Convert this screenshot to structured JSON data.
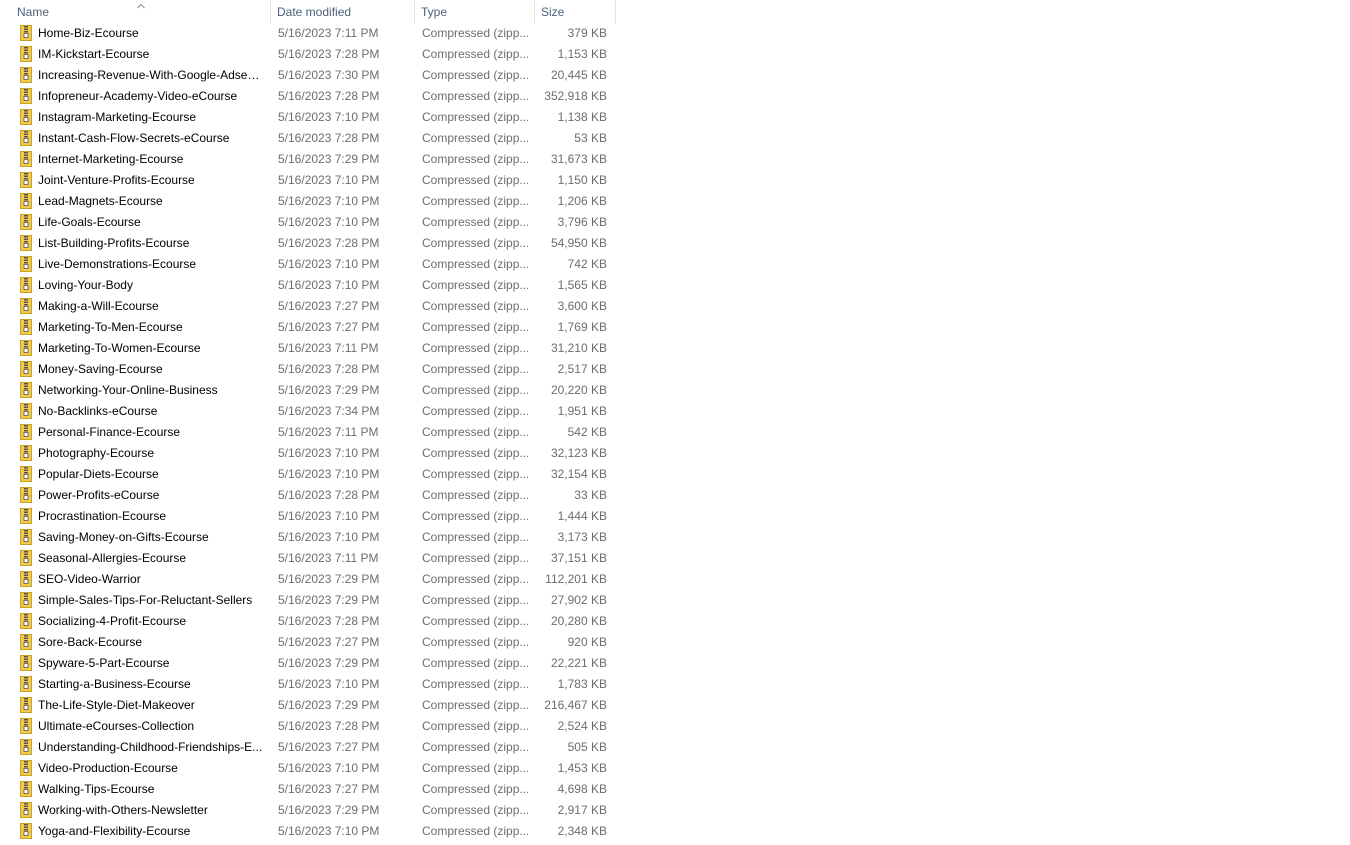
{
  "columns": {
    "name": "Name",
    "date_modified": "Date modified",
    "type": "Type",
    "size": "Size"
  },
  "sort_indicator": "chevron-up-icon",
  "file_icon": "zip-folder-icon",
  "colors": {
    "header_text": "#4c607a",
    "secondary_text": "#6d6d6d",
    "zip_folder": "#f2c94c"
  },
  "files": [
    {
      "name": "Home-Biz-Ecourse",
      "date": "5/16/2023 7:11 PM",
      "type": "Compressed (zipp...",
      "size": "379 KB"
    },
    {
      "name": "IM-Kickstart-Ecourse",
      "date": "5/16/2023 7:28 PM",
      "type": "Compressed (zipp...",
      "size": "1,153 KB"
    },
    {
      "name": "Increasing-Revenue-With-Google-Adsense",
      "date": "5/16/2023 7:30 PM",
      "type": "Compressed (zipp...",
      "size": "20,445 KB"
    },
    {
      "name": "Infopreneur-Academy-Video-eCourse",
      "date": "5/16/2023 7:28 PM",
      "type": "Compressed (zipp...",
      "size": "352,918 KB"
    },
    {
      "name": "Instagram-Marketing-Ecourse",
      "date": "5/16/2023 7:10 PM",
      "type": "Compressed (zipp...",
      "size": "1,138 KB"
    },
    {
      "name": "Instant-Cash-Flow-Secrets-eCourse",
      "date": "5/16/2023 7:28 PM",
      "type": "Compressed (zipp...",
      "size": "53 KB"
    },
    {
      "name": "Internet-Marketing-Ecourse",
      "date": "5/16/2023 7:29 PM",
      "type": "Compressed (zipp...",
      "size": "31,673 KB"
    },
    {
      "name": "Joint-Venture-Profits-Ecourse",
      "date": "5/16/2023 7:10 PM",
      "type": "Compressed (zipp...",
      "size": "1,150 KB"
    },
    {
      "name": "Lead-Magnets-Ecourse",
      "date": "5/16/2023 7:10 PM",
      "type": "Compressed (zipp...",
      "size": "1,206 KB"
    },
    {
      "name": "Life-Goals-Ecourse",
      "date": "5/16/2023 7:10 PM",
      "type": "Compressed (zipp...",
      "size": "3,796 KB"
    },
    {
      "name": "List-Building-Profits-Ecourse",
      "date": "5/16/2023 7:28 PM",
      "type": "Compressed (zipp...",
      "size": "54,950 KB"
    },
    {
      "name": "Live-Demonstrations-Ecourse",
      "date": "5/16/2023 7:10 PM",
      "type": "Compressed (zipp...",
      "size": "742 KB"
    },
    {
      "name": "Loving-Your-Body",
      "date": "5/16/2023 7:10 PM",
      "type": "Compressed (zipp...",
      "size": "1,565 KB"
    },
    {
      "name": "Making-a-Will-Ecourse",
      "date": "5/16/2023 7:27 PM",
      "type": "Compressed (zipp...",
      "size": "3,600 KB"
    },
    {
      "name": "Marketing-To-Men-Ecourse",
      "date": "5/16/2023 7:27 PM",
      "type": "Compressed (zipp...",
      "size": "1,769 KB"
    },
    {
      "name": "Marketing-To-Women-Ecourse",
      "date": "5/16/2023 7:11 PM",
      "type": "Compressed (zipp...",
      "size": "31,210 KB"
    },
    {
      "name": "Money-Saving-Ecourse",
      "date": "5/16/2023 7:28 PM",
      "type": "Compressed (zipp...",
      "size": "2,517 KB"
    },
    {
      "name": "Networking-Your-Online-Business",
      "date": "5/16/2023 7:29 PM",
      "type": "Compressed (zipp...",
      "size": "20,220 KB"
    },
    {
      "name": "No-Backlinks-eCourse",
      "date": "5/16/2023 7:34 PM",
      "type": "Compressed (zipp...",
      "size": "1,951 KB"
    },
    {
      "name": "Personal-Finance-Ecourse",
      "date": "5/16/2023 7:11 PM",
      "type": "Compressed (zipp...",
      "size": "542 KB"
    },
    {
      "name": "Photography-Ecourse",
      "date": "5/16/2023 7:10 PM",
      "type": "Compressed (zipp...",
      "size": "32,123 KB"
    },
    {
      "name": "Popular-Diets-Ecourse",
      "date": "5/16/2023 7:10 PM",
      "type": "Compressed (zipp...",
      "size": "32,154 KB"
    },
    {
      "name": "Power-Profits-eCourse",
      "date": "5/16/2023 7:28 PM",
      "type": "Compressed (zipp...",
      "size": "33 KB"
    },
    {
      "name": "Procrastination-Ecourse",
      "date": "5/16/2023 7:10 PM",
      "type": "Compressed (zipp...",
      "size": "1,444 KB"
    },
    {
      "name": "Saving-Money-on-Gifts-Ecourse",
      "date": "5/16/2023 7:10 PM",
      "type": "Compressed (zipp...",
      "size": "3,173 KB"
    },
    {
      "name": "Seasonal-Allergies-Ecourse",
      "date": "5/16/2023 7:11 PM",
      "type": "Compressed (zipp...",
      "size": "37,151 KB"
    },
    {
      "name": "SEO-Video-Warrior",
      "date": "5/16/2023 7:29 PM",
      "type": "Compressed (zipp...",
      "size": "112,201 KB"
    },
    {
      "name": "Simple-Sales-Tips-For-Reluctant-Sellers",
      "date": "5/16/2023 7:29 PM",
      "type": "Compressed (zipp...",
      "size": "27,902 KB"
    },
    {
      "name": "Socializing-4-Profit-Ecourse",
      "date": "5/16/2023 7:28 PM",
      "type": "Compressed (zipp...",
      "size": "20,280 KB"
    },
    {
      "name": "Sore-Back-Ecourse",
      "date": "5/16/2023 7:27 PM",
      "type": "Compressed (zipp...",
      "size": "920 KB"
    },
    {
      "name": "Spyware-5-Part-Ecourse",
      "date": "5/16/2023 7:29 PM",
      "type": "Compressed (zipp...",
      "size": "22,221 KB"
    },
    {
      "name": "Starting-a-Business-Ecourse",
      "date": "5/16/2023 7:10 PM",
      "type": "Compressed (zipp...",
      "size": "1,783 KB"
    },
    {
      "name": "The-Life-Style-Diet-Makeover",
      "date": "5/16/2023 7:29 PM",
      "type": "Compressed (zipp...",
      "size": "216,467 KB"
    },
    {
      "name": "Ultimate-eCourses-Collection",
      "date": "5/16/2023 7:28 PM",
      "type": "Compressed (zipp...",
      "size": "2,524 KB"
    },
    {
      "name": "Understanding-Childhood-Friendships-E...",
      "date": "5/16/2023 7:27 PM",
      "type": "Compressed (zipp...",
      "size": "505 KB"
    },
    {
      "name": "Video-Production-Ecourse",
      "date": "5/16/2023 7:10 PM",
      "type": "Compressed (zipp...",
      "size": "1,453 KB"
    },
    {
      "name": "Walking-Tips-Ecourse",
      "date": "5/16/2023 7:27 PM",
      "type": "Compressed (zipp...",
      "size": "4,698 KB"
    },
    {
      "name": "Working-with-Others-Newsletter",
      "date": "5/16/2023 7:29 PM",
      "type": "Compressed (zipp...",
      "size": "2,917 KB"
    },
    {
      "name": "Yoga-and-Flexibility-Ecourse",
      "date": "5/16/2023 7:10 PM",
      "type": "Compressed (zipp...",
      "size": "2,348 KB"
    }
  ]
}
